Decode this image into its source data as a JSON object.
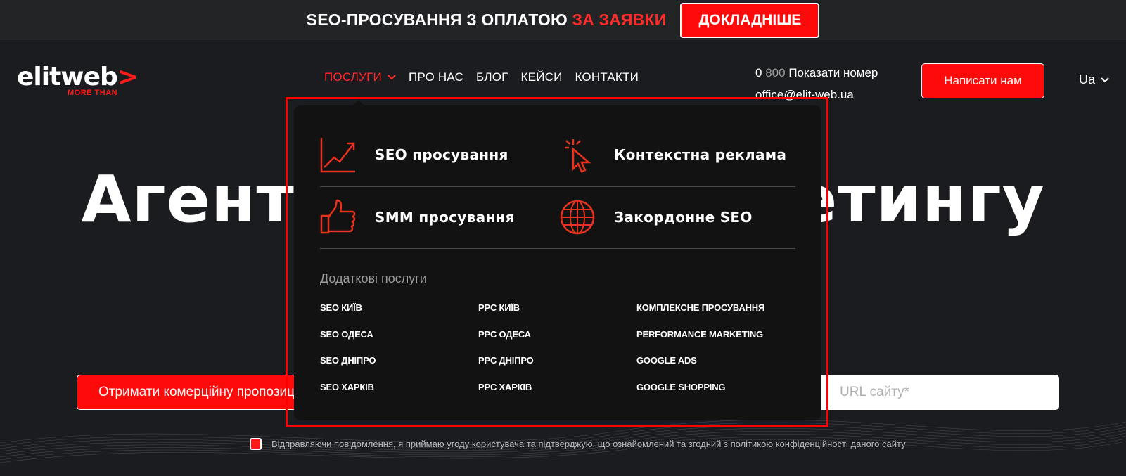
{
  "promo": {
    "text": "SEO-ПРОСУВАННЯ З ОПЛАТОЮ",
    "highlight": "ЗА ЗАЯВКИ",
    "button": "ДОКЛАДНІШЕ"
  },
  "logo": {
    "main": "elitweb",
    "chevron": ">",
    "sub": "MORE THAN"
  },
  "nav": {
    "items": [
      {
        "label": "ПОСЛУГИ",
        "active": true
      },
      {
        "label": "ПРО НАС"
      },
      {
        "label": "БЛОГ"
      },
      {
        "label": "КЕЙСИ"
      },
      {
        "label": "КОНТАКТИ"
      }
    ]
  },
  "contact": {
    "phone_prefix": "0",
    "phone_mid": "800",
    "phone_action": "Показати номер",
    "email": "office@elit-web.ua"
  },
  "header": {
    "write_button": "Написати нам",
    "lang": "Ua"
  },
  "hero": {
    "title_left": "Агентс",
    "title_right": "кетингу",
    "cta": "Отримати комерційну пропозиц",
    "url_placeholder": "URL сайту*",
    "consent": "Відправляючи повідомлення, я приймаю угоду користувача та підтверджую, що ознайомлений та згодний з політикою конфіденційності даного сайту"
  },
  "dropdown": {
    "services": [
      {
        "label": "SEO просування",
        "icon": "chart-up-icon"
      },
      {
        "label": "Контекстна реклама",
        "icon": "cursor-click-icon"
      },
      {
        "label": "SMM просування",
        "icon": "thumbs-up-icon"
      },
      {
        "label": "Закордонне SEO",
        "icon": "globe-icon"
      }
    ],
    "extra_title": "Додаткові послуги",
    "extra": [
      [
        "SEO КИЇВ",
        "SEO ОДЕСА",
        "SEO ДНІПРО",
        "SEO ХАРКІВ"
      ],
      [
        "PPC КИЇВ",
        "PPC ОДЕСА",
        "PPC ДНІПРО",
        "PPC ХАРКІВ"
      ],
      [
        "КОМПЛЕКСНЕ ПРОСУВАННЯ",
        "PERFORMANCE MARKETING",
        "GOOGLE ADS",
        "GOOGLE SHOPPING"
      ]
    ]
  },
  "colors": {
    "accent": "#ff0a0a",
    "background": "#1b1c1f",
    "dropdown": "#121212"
  }
}
